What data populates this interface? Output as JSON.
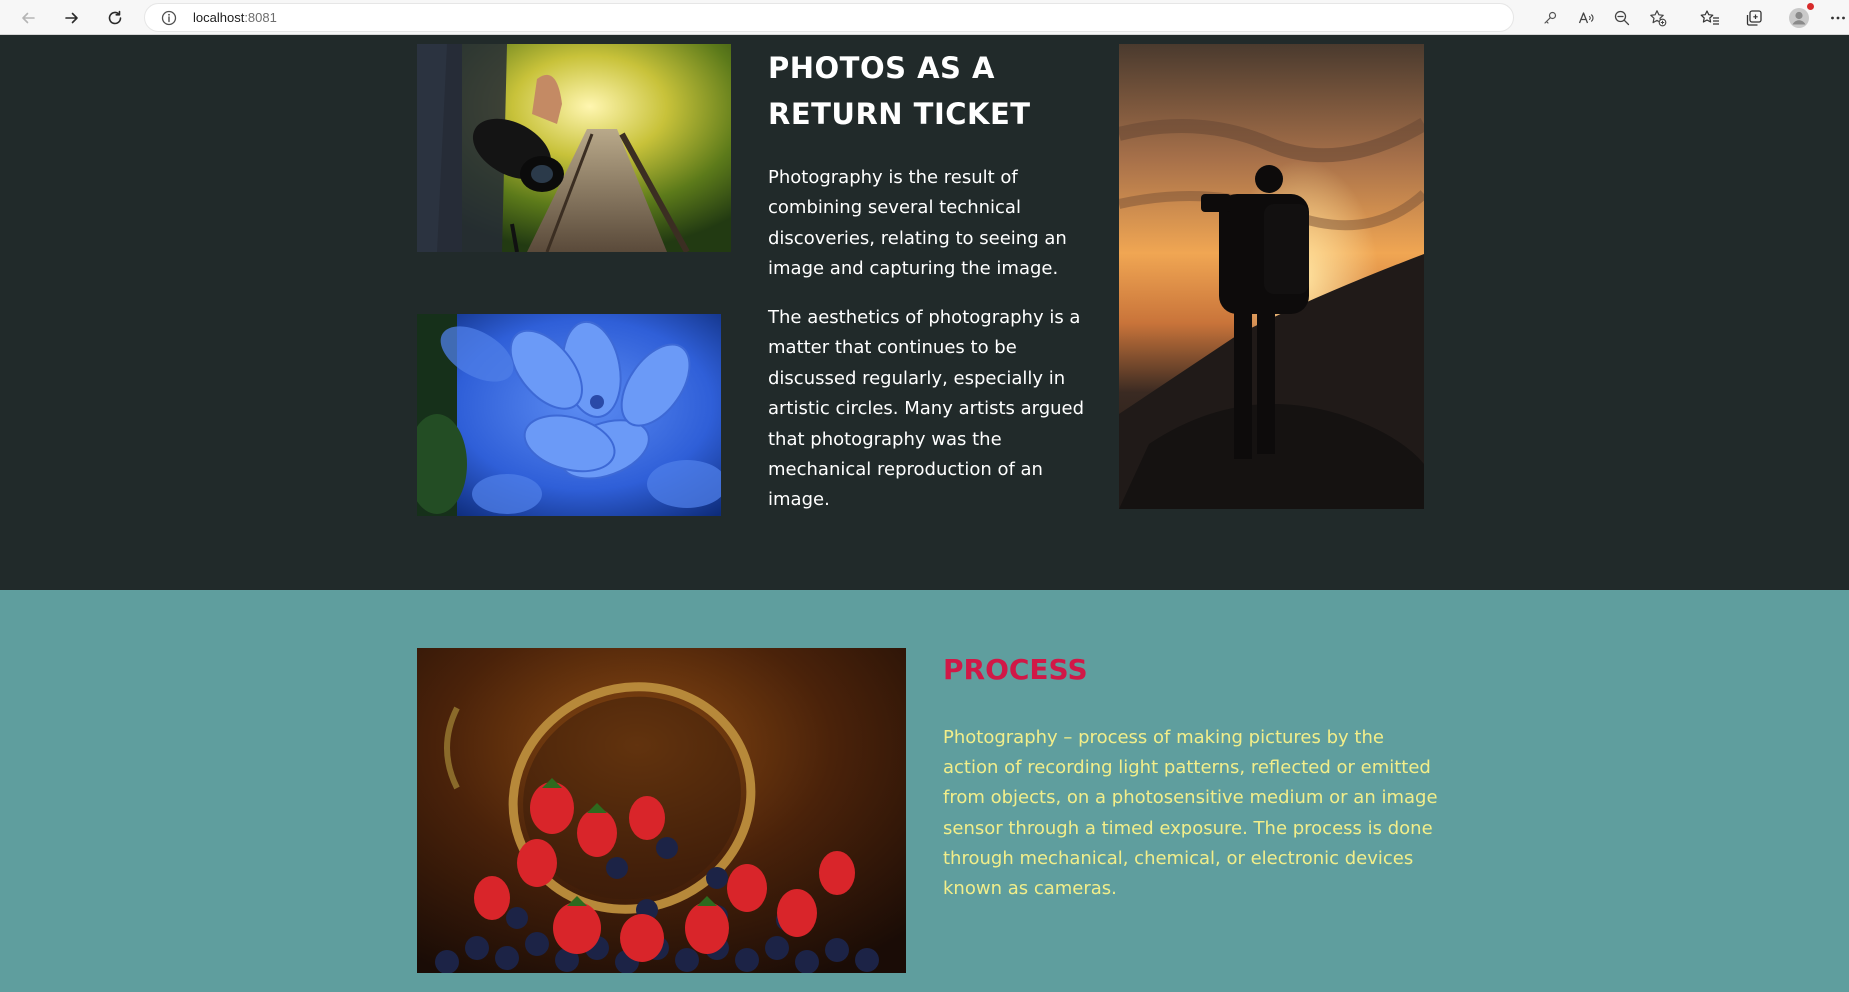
{
  "browser": {
    "url_host": "localhost",
    "url_port": ":8081",
    "accent_profile_dot": "#d72b2b",
    "icons": [
      "back-icon",
      "forward-icon",
      "reload-icon",
      "info-icon",
      "key-icon",
      "read-aloud-icon",
      "zoom-out-icon",
      "add-favorite-icon",
      "favorites-icon",
      "collections-icon",
      "profile-icon",
      "more-icon"
    ]
  },
  "hero": {
    "title": "PHOTOS AS A RETURN TICKET",
    "paragraphs": [
      "Photography is the result of combining several technical discoveries, relating to seeing an image and capturing the image.",
      "The aesthetics of photography is a matter that continues to be discussed regularly, especially in artistic circles. Many artists argued that photography was the mechanical reproduction of an image."
    ],
    "background": "#212a2a",
    "images": [
      "camera-on-boardwalk-photo",
      "blue-flower-photo",
      "photographer-sunset-photo"
    ]
  },
  "process": {
    "title": "PROCESS",
    "text": "Photography – process of making pictures by the action of recording light patterns, reflected or emitted from objects, on a photosensitive medium or an image sensor through a timed exposure. The process is done through mechanical, chemical, or electronic devices known as cameras.",
    "background": "#5f9e9e",
    "title_color": "#d11847",
    "text_color": "#f2ee8a",
    "image": "berries-bowl-photo"
  }
}
